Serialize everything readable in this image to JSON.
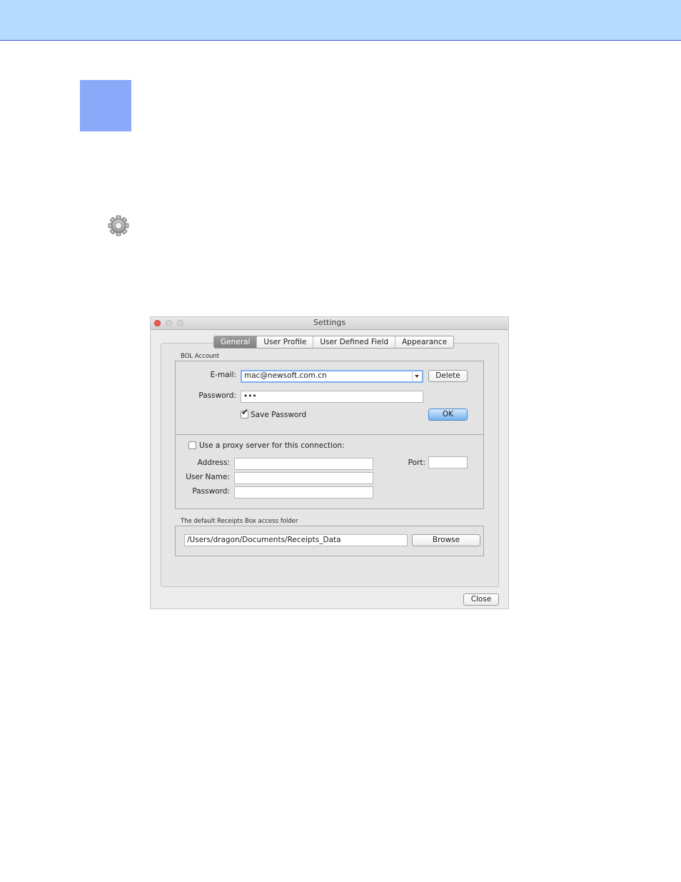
{
  "settings_window": {
    "title": "Settings",
    "tabs": [
      {
        "label": "General",
        "active": true
      },
      {
        "label": "User Profile",
        "active": false
      },
      {
        "label": "User Defined Field",
        "active": false
      },
      {
        "label": "Appearance",
        "active": false
      }
    ],
    "bol_account": {
      "group_label": "BOL Account",
      "email_label": "E-mail:",
      "email_value": "mac@newsoft.com.cn",
      "delete_label": "Delete",
      "password_label": "Password:",
      "password_value": "•••",
      "save_password_label": "Save Password",
      "save_password_checked": true,
      "ok_label": "OK"
    },
    "proxy": {
      "use_proxy_label": "Use a proxy server for this connection:",
      "use_proxy_checked": false,
      "address_label": "Address:",
      "address_value": "",
      "port_label": "Port:",
      "port_value": "",
      "username_label": "User Name:",
      "username_value": "",
      "password_label": "Password:",
      "password_value": ""
    },
    "folder": {
      "group_label": "The default Receipts Box access folder",
      "path_value": "/Users/dragon/Documents/Receipts_Data",
      "browse_label": "Browse"
    },
    "close_label": "Close"
  },
  "icons": {
    "gear": "gear-icon",
    "window_close": "close-icon",
    "window_minimize": "minimize-icon",
    "window_zoom": "zoom-icon",
    "dropdown": "chevron-down-icon",
    "checkmark": "checkmark-icon"
  },
  "colors": {
    "top_band": "#b6dcfd",
    "blue_square": "#8aaaf9",
    "default_button": "#74b4ef",
    "close_light": "#ee5a52"
  }
}
